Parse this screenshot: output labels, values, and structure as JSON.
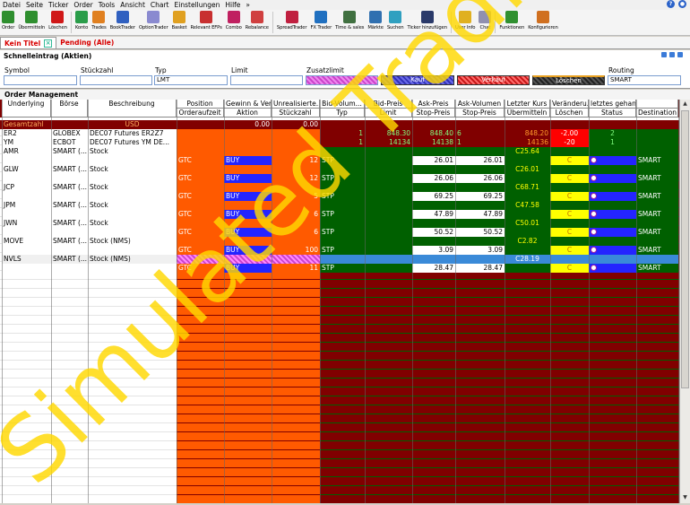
{
  "menu": {
    "items": [
      "Datei",
      "Seite",
      "Ticker",
      "Order",
      "Tools",
      "Ansicht",
      "Chart",
      "Einstellungen",
      "Hilfe",
      "»"
    ]
  },
  "toolbar": {
    "buttons": [
      {
        "label": "Order",
        "icon": "order-icon",
        "color": "#2f8f2f"
      },
      {
        "label": "Übermitteln",
        "icon": "transmit-icon",
        "color": "#2f8f2f"
      },
      {
        "label": "Löschen",
        "icon": "delete-icon",
        "color": "#d01818"
      },
      {
        "label": "Konto",
        "icon": "account-icon",
        "color": "#2a9d4a"
      },
      {
        "label": "Trades",
        "icon": "trades-icon",
        "color": "#e08020"
      },
      {
        "label": "BookTrader",
        "icon": "booktrader-icon",
        "color": "#3060c0"
      },
      {
        "label": "OptionTrader",
        "icon": "optiontrader-icon",
        "color": "#8a8ad0"
      },
      {
        "label": "Basket",
        "icon": "basket-icon",
        "color": "#e0a020"
      },
      {
        "label": "Relevant EFPs",
        "icon": "efp-icon",
        "color": "#c83030"
      },
      {
        "label": "Combo",
        "icon": "combo-icon",
        "color": "#c02060"
      },
      {
        "label": "Rebalance",
        "icon": "rebalance-icon",
        "color": "#d04040"
      },
      {
        "label": "SpreadTrader",
        "icon": "spreadtrader-icon",
        "color": "#c02040"
      },
      {
        "label": "FX Trader",
        "icon": "fx-icon",
        "color": "#2070c0"
      },
      {
        "label": "Time & sales",
        "icon": "time-sales-icon",
        "color": "#407040"
      },
      {
        "label": "Märkte",
        "icon": "markets-icon",
        "color": "#3070b0"
      },
      {
        "label": "Suchen",
        "icon": "search-icon",
        "color": "#30a0c0"
      },
      {
        "label": "Ticker hinzufügen",
        "icon": "add-ticker-icon",
        "color": "#2a3a6a"
      },
      {
        "label": "User Info",
        "icon": "user-info-icon",
        "color": "#e0b020"
      },
      {
        "label": "Chat",
        "icon": "chat-icon",
        "color": "#9090b0"
      },
      {
        "label": "Funktionen",
        "icon": "functions-icon",
        "color": "#309030"
      },
      {
        "label": "Konfigurieren",
        "icon": "configure-icon",
        "color": "#d07020"
      }
    ]
  },
  "tabs": [
    {
      "label": "Kein Titel",
      "active": true
    },
    {
      "label": "Pending (Alle)",
      "active": false
    }
  ],
  "quick_entry": {
    "title": "Schnelleintrag (Aktien)",
    "fields": {
      "symbol": "Symbol",
      "quantity": "Stückzahl",
      "type": "Typ",
      "limit": "Limit",
      "aux": "Zusatzlimit",
      "routing": "Routing"
    },
    "type_value": "LMT",
    "routing_value": "SMART",
    "buy_label": "Kauf",
    "sell_label": "Verkauf",
    "delete_label": "Löschen"
  },
  "order_management": {
    "title": "Order Management",
    "headers_top": [
      "Underlying",
      "Börse",
      "Beschreibung",
      "Position",
      "Gewinn & Ver...",
      "Unrealisierte...",
      "Bid-Volum...",
      "Bid-Preis",
      "Ask-Preis",
      "Ask-Volumen",
      "Letzter Kurs",
      "Veränderu...",
      "letztes gehan...",
      ""
    ],
    "headers_bottom": [
      "",
      "",
      "",
      "Orderaufzeit",
      "Aktion",
      "Stückzahl",
      "Typ",
      "Limit",
      "Stop-Preis",
      "Stop-Preis",
      "Übermitteln",
      "Löschen",
      "Status",
      "Destination"
    ],
    "total_row": {
      "label": "Gesamtzahl",
      "currency": "USD",
      "pnl": "0.00",
      "unrealized": "0.00"
    },
    "futures": [
      {
        "symbol": "ER2",
        "exchange": "GLOBEX",
        "desc": "DEC07 Futures ER2Z7",
        "bid_vol": "1",
        "bid": "848.30",
        "ask": "848.40",
        "ask_vol": "6",
        "last": "848.20",
        "change": "-2.00",
        "last_traded": "2"
      },
      {
        "symbol": "YM",
        "exchange": "ECBOT",
        "desc": "DEC07 Futures YM  DE...",
        "bid_vol": "1",
        "bid": "14134",
        "ask": "14138",
        "ask_vol": "1",
        "last": "14136",
        "change": "-20",
        "last_traded": "1"
      }
    ],
    "stocks": [
      {
        "symbol": "AMR",
        "exchange": "SMART (...",
        "desc": "Stock",
        "last": "C25.64",
        "tif": "GTC",
        "action": "BUY",
        "qty": "12",
        "type": "STP",
        "limit": "26.01",
        "stop": "26.01",
        "transmit": "C",
        "dest": "SMART"
      },
      {
        "symbol": "GLW",
        "exchange": "SMART (...",
        "desc": "Stock",
        "last": "C26.01",
        "tif": "GTC",
        "action": "BUY",
        "qty": "12",
        "type": "STP",
        "limit": "26.06",
        "stop": "26.06",
        "transmit": "C",
        "dest": "SMART"
      },
      {
        "symbol": "JCP",
        "exchange": "SMART (...",
        "desc": "Stock",
        "last": "C68.71",
        "tif": "GTC",
        "action": "BUY",
        "qty": "5",
        "type": "STP",
        "limit": "69.25",
        "stop": "69.25",
        "transmit": "C",
        "dest": "SMART"
      },
      {
        "symbol": "JPM",
        "exchange": "SMART (...",
        "desc": "Stock",
        "last": "C47.58",
        "tif": "GTC",
        "action": "BUY",
        "qty": "6",
        "type": "STP",
        "limit": "47.89",
        "stop": "47.89",
        "transmit": "C",
        "dest": "SMART"
      },
      {
        "symbol": "JWN",
        "exchange": "SMART (...",
        "desc": "Stock",
        "last": "C50.01",
        "tif": "GTC",
        "action": "BUY",
        "qty": "6",
        "type": "STP",
        "limit": "50.52",
        "stop": "50.52",
        "transmit": "C",
        "dest": "SMART"
      },
      {
        "symbol": "MOVE",
        "exchange": "SMART (...",
        "desc": "Stock (NMS)",
        "last": "C2.82",
        "tif": "GTC",
        "action": "BUY",
        "qty": "100",
        "type": "STP",
        "limit": "3.09",
        "stop": "3.09",
        "transmit": "C",
        "dest": "SMART"
      },
      {
        "symbol": "NVLS",
        "exchange": "SMART (...",
        "desc": "Stock (NMS)",
        "last": "C28.19",
        "tif": "GTC",
        "action": "BUY",
        "qty": "11",
        "type": "STP",
        "limit": "28.47",
        "stop": "28.47",
        "transmit": "C",
        "dest": "SMART",
        "selected": true
      }
    ]
  },
  "watermark": "Simulated Trading",
  "colors": {
    "orange": "#ff5a00",
    "darkred": "#800000",
    "green": "#006000",
    "blue": "#2424ff",
    "yellow": "#ffff00",
    "bidgreen": "#80ff80",
    "lastorange": "#ff9a2a"
  }
}
